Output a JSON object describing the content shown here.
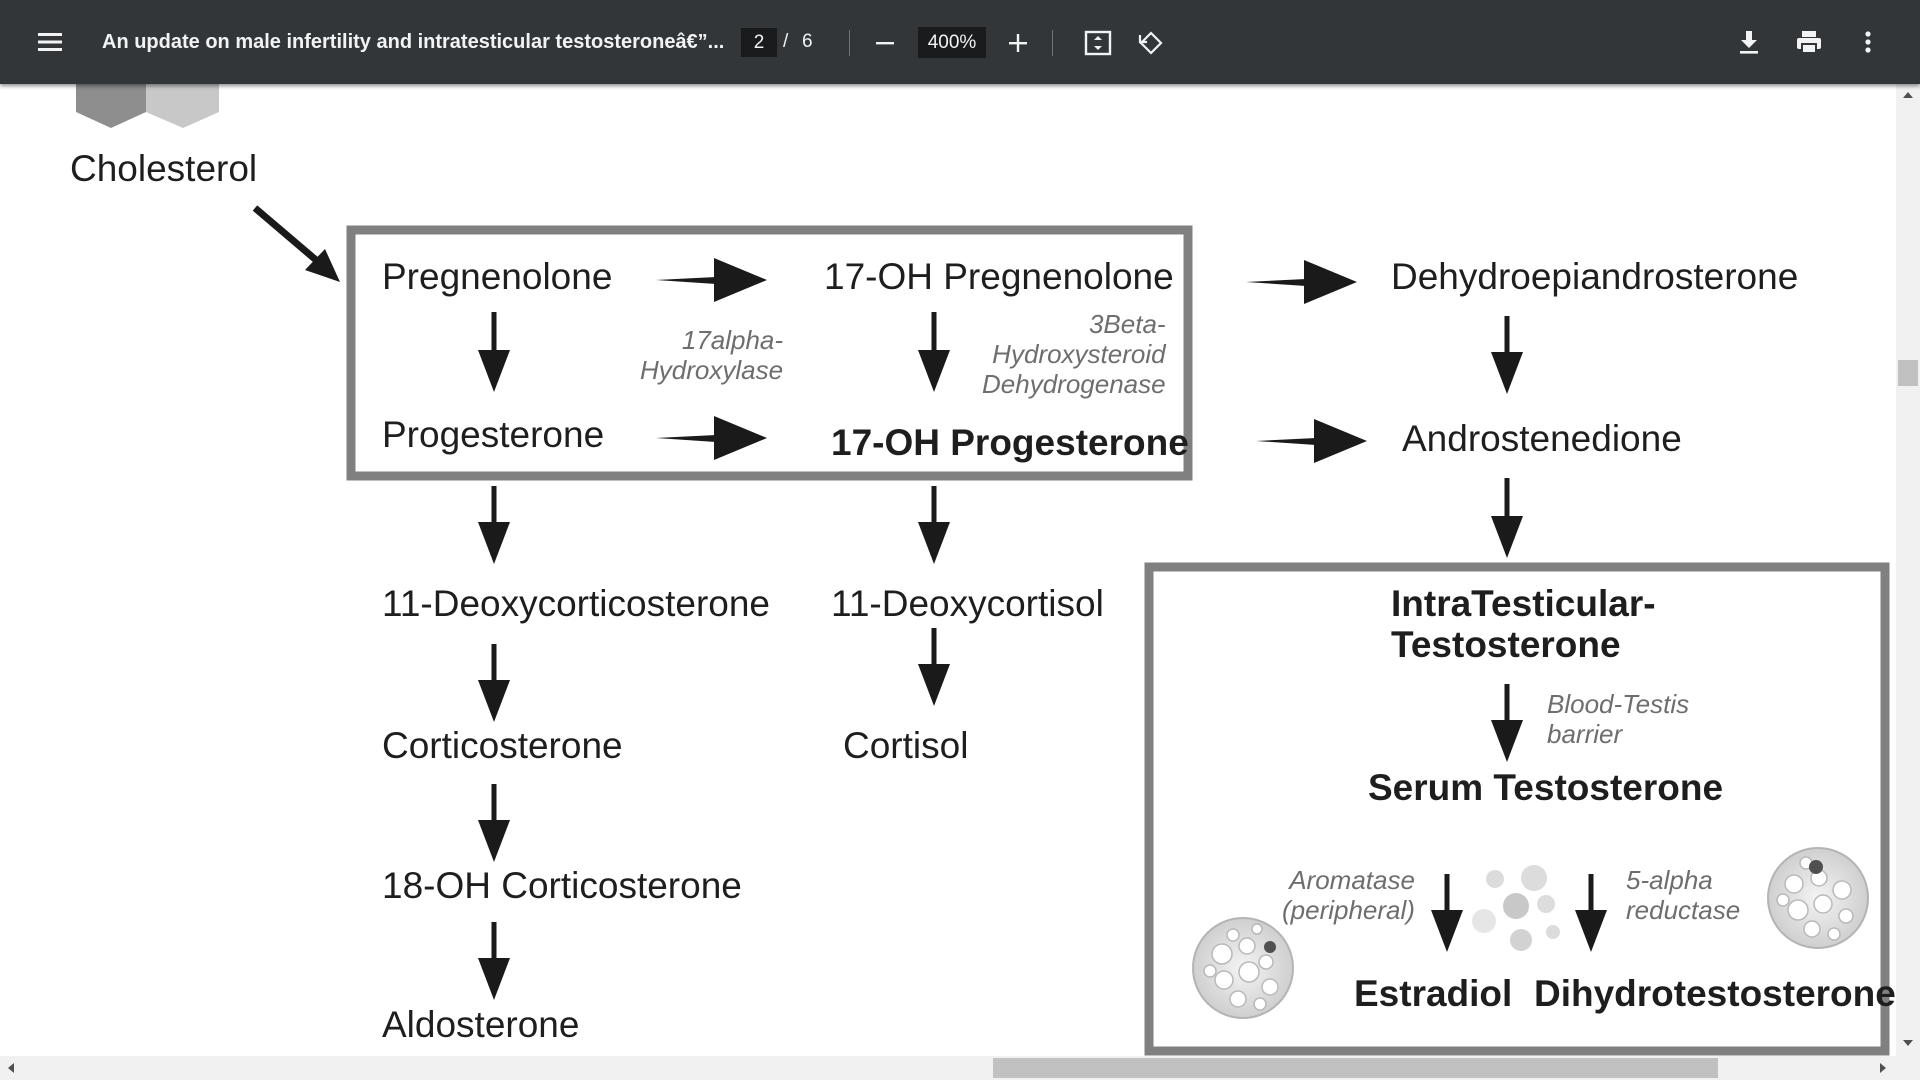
{
  "toolbar": {
    "menu_icon": "hamburger-menu-icon",
    "title": "An update on male infertility and intratesticular testosteroneâ€”...",
    "page_current": "2",
    "page_separator": "/",
    "page_total": "6",
    "zoom_out_icon": "minus-icon",
    "zoom_value": "400%",
    "zoom_in_icon": "plus-icon",
    "fit_icon": "fit-to-page-icon",
    "rotate_icon": "rotate-icon",
    "download_icon": "download-icon",
    "print_icon": "print-icon",
    "more_icon": "more-vertical-icon"
  },
  "diagram": {
    "cholesterol": "Cholesterol",
    "pregnenolone": "Pregnenolone",
    "oh17_pregnenolone": "17-OH Pregnenolone",
    "dhea": "Dehydroepiandrosterone",
    "enzyme_17alpha": "17alpha-\nHydroxylase",
    "enzyme_3beta": "3Beta-\nHydroxysteroid\nDehydrogenase",
    "progesterone": "Progesterone",
    "oh17_progesterone": "17-OH Progesterone",
    "androstenedione": "Androstenedione",
    "deoxycorticosterone": "11-Deoxycorticosterone",
    "deoxycortisol": "11-Deoxycortisol",
    "corticosterone": "Corticosterone",
    "cortisol": "Cortisol",
    "oh18_corticosterone": "18-OH Corticosterone",
    "aldosterone": "Aldosterone",
    "intratesticular_line1": "IntraTesticular-",
    "intratesticular_line2": "Testosterone",
    "blood_testis": "Blood-Testis\nbarrier",
    "serum_testosterone": "Serum Testosterone",
    "aromatase": "Aromatase\n(peripheral)",
    "five_alpha": "5-alpha\nreductase",
    "estradiol": "Estradiol",
    "dht": "Dihydrotestosterone"
  },
  "colors": {
    "toolbar_bg": "#323639",
    "toolbar_text": "#f1f3f4",
    "page_bg": "#ffffff",
    "box_border": "#808080",
    "text": "#1e1e1e",
    "enzyme_text": "#6e6e6e"
  }
}
